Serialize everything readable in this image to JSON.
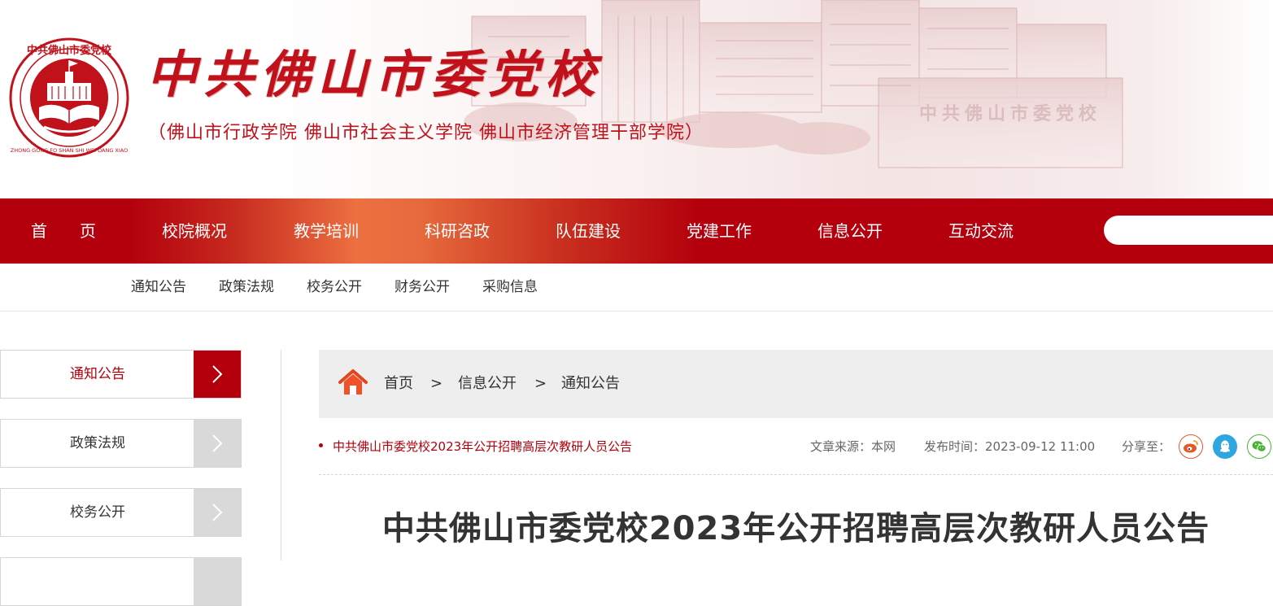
{
  "header": {
    "title": "中共佛山市委党校",
    "subtitle": "（佛山市行政学院   佛山市社会主义学院   佛山市经济管理干部学院）",
    "watermark": "中共佛山市委党校",
    "logo": {
      "ring_text": "中共佛山市委党校",
      "ring_pinyin": "ZHONG GONG FO SHAN SHI WEI DANG XIAO",
      "icon": "school-emblem-icon"
    }
  },
  "nav": {
    "items": [
      {
        "label": "首　　页"
      },
      {
        "label": "校院概况"
      },
      {
        "label": "教学培训"
      },
      {
        "label": "科研咨政"
      },
      {
        "label": "队伍建设"
      },
      {
        "label": "党建工作"
      },
      {
        "label": "信息公开"
      },
      {
        "label": "互动交流"
      }
    ],
    "search_placeholder": ""
  },
  "subnav": {
    "items": [
      {
        "label": "通知公告"
      },
      {
        "label": "政策法规"
      },
      {
        "label": "校务公开"
      },
      {
        "label": "财务公开"
      },
      {
        "label": "采购信息"
      }
    ]
  },
  "sidebar": {
    "items": [
      {
        "label": "通知公告",
        "active": true
      },
      {
        "label": "政策法规",
        "active": false
      },
      {
        "label": "校务公开",
        "active": false
      }
    ]
  },
  "breadcrumb": {
    "icon": "home-icon",
    "items": [
      "首页",
      "信息公开",
      "通知公告"
    ],
    "separator": ">"
  },
  "article": {
    "link_title": "中共佛山市委党校2023年公开招聘高层次教研人员公告",
    "source": "文章来源：本网",
    "published": "发布时间：2023-09-12 11:00",
    "share_label": "分享至：",
    "share_icons": [
      "weibo-icon",
      "qq-icon",
      "wechat-icon"
    ],
    "title": "中共佛山市委党校2023年公开招聘高层次教研人员公告"
  },
  "colors": {
    "brand_red": "#b3000c",
    "title_red": "#c1121b",
    "nav_highlight": "#ec7040",
    "weibo": "#e6562b",
    "qq": "#2ea7e0",
    "wechat": "#49b233"
  }
}
